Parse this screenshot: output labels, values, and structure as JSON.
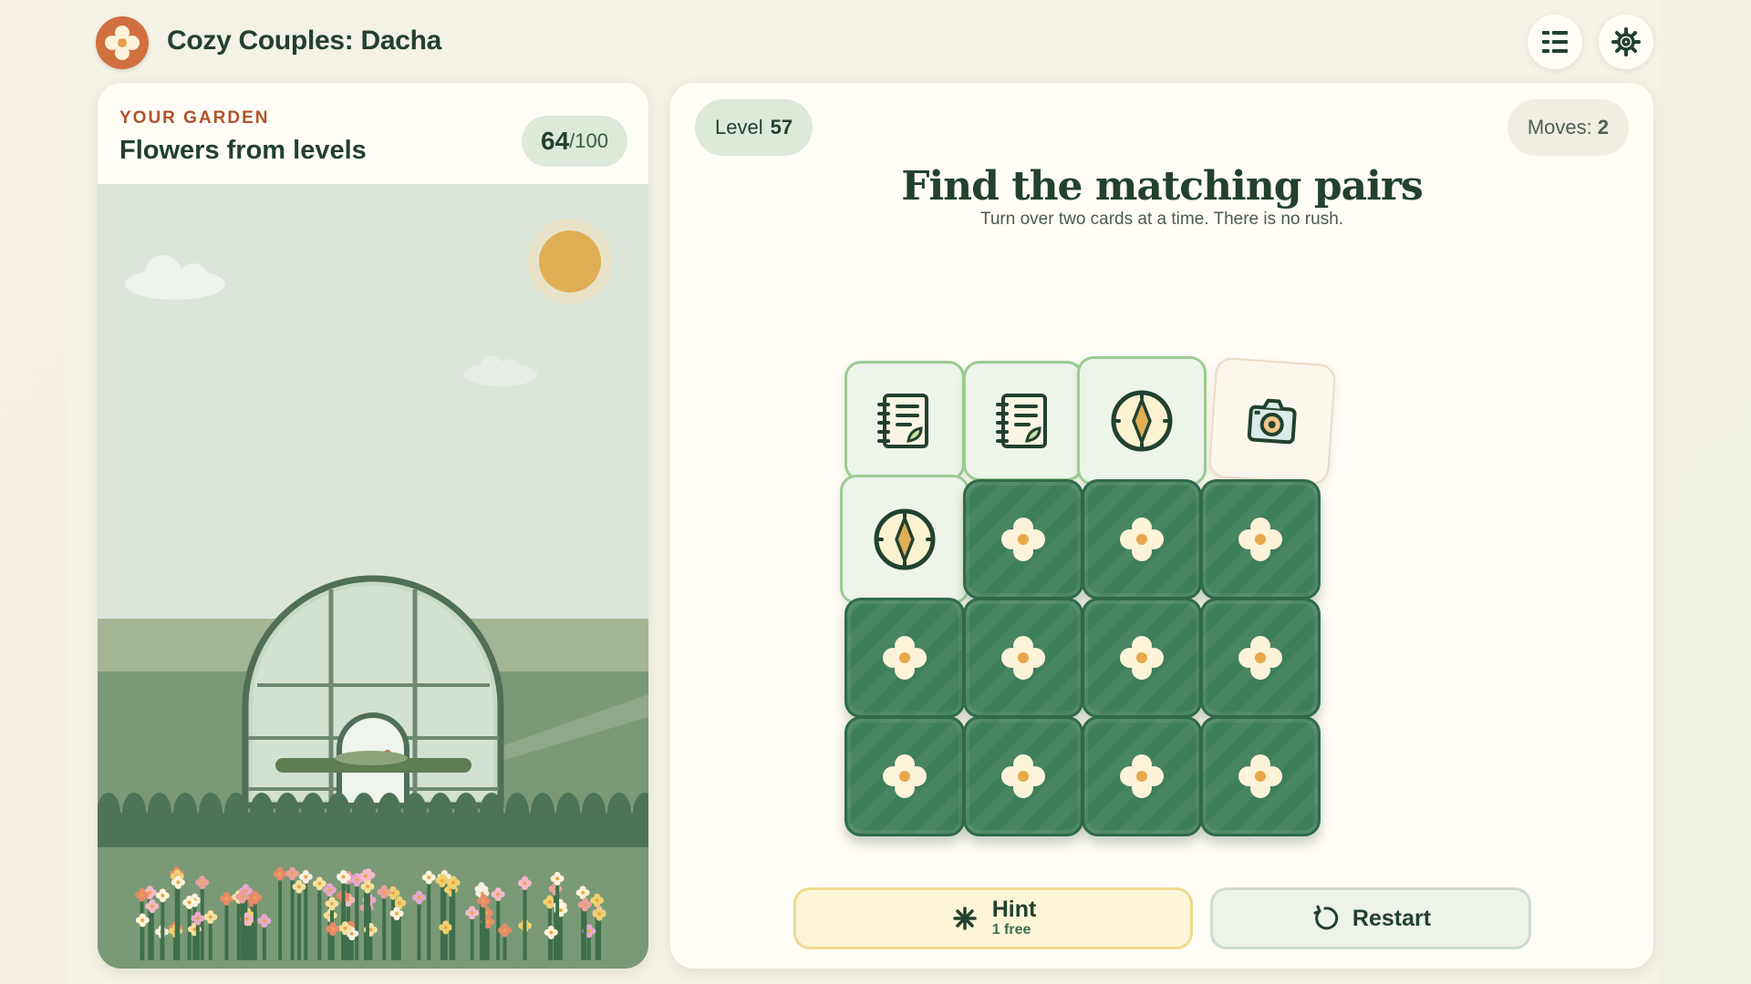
{
  "app": {
    "title": "Cozy Couples: Dacha",
    "logo_icon": "flower-logo-icon"
  },
  "header": {
    "menu_icon": "list-menu-icon",
    "settings_icon": "gear-icon"
  },
  "garden": {
    "kicker": "YOUR GARDEN",
    "title": "Flowers from levels",
    "progress": {
      "current": "64",
      "separator": "/",
      "max": "100"
    }
  },
  "game": {
    "level_label": "Level",
    "level_value": "57",
    "moves_label": "Moves:",
    "moves_value": "2",
    "heading": "Find the matching pairs",
    "subheading": "Turn over two cards at a time. There is no rush.",
    "cards": [
      {
        "state": "matched",
        "icon": "notebook-icon"
      },
      {
        "state": "matched",
        "icon": "notebook-icon"
      },
      {
        "state": "matched",
        "icon": "compass-icon"
      },
      {
        "state": "revealed",
        "icon": "camera-icon"
      },
      {
        "state": "matched",
        "icon": "compass-icon"
      },
      {
        "state": "hidden",
        "icon": "flower-icon"
      },
      {
        "state": "hidden",
        "icon": "flower-icon"
      },
      {
        "state": "hidden",
        "icon": "flower-icon"
      },
      {
        "state": "hidden",
        "icon": "flower-icon"
      },
      {
        "state": "hidden",
        "icon": "flower-icon"
      },
      {
        "state": "hidden",
        "icon": "flower-icon"
      },
      {
        "state": "hidden",
        "icon": "flower-icon"
      },
      {
        "state": "hidden",
        "icon": "flower-icon"
      },
      {
        "state": "hidden",
        "icon": "flower-icon"
      },
      {
        "state": "hidden",
        "icon": "flower-icon"
      },
      {
        "state": "hidden",
        "icon": "flower-icon"
      }
    ],
    "hint": {
      "label": "Hint",
      "sub": "1 free",
      "icon": "sparkle-icon"
    },
    "restart": {
      "label": "Restart",
      "icon": "restart-icon"
    }
  },
  "colors": {
    "card_back": "#3e7f5b",
    "card_matched": "#edf5ea",
    "accent_orange": "#d0703f",
    "sun": "#e0ae55"
  }
}
